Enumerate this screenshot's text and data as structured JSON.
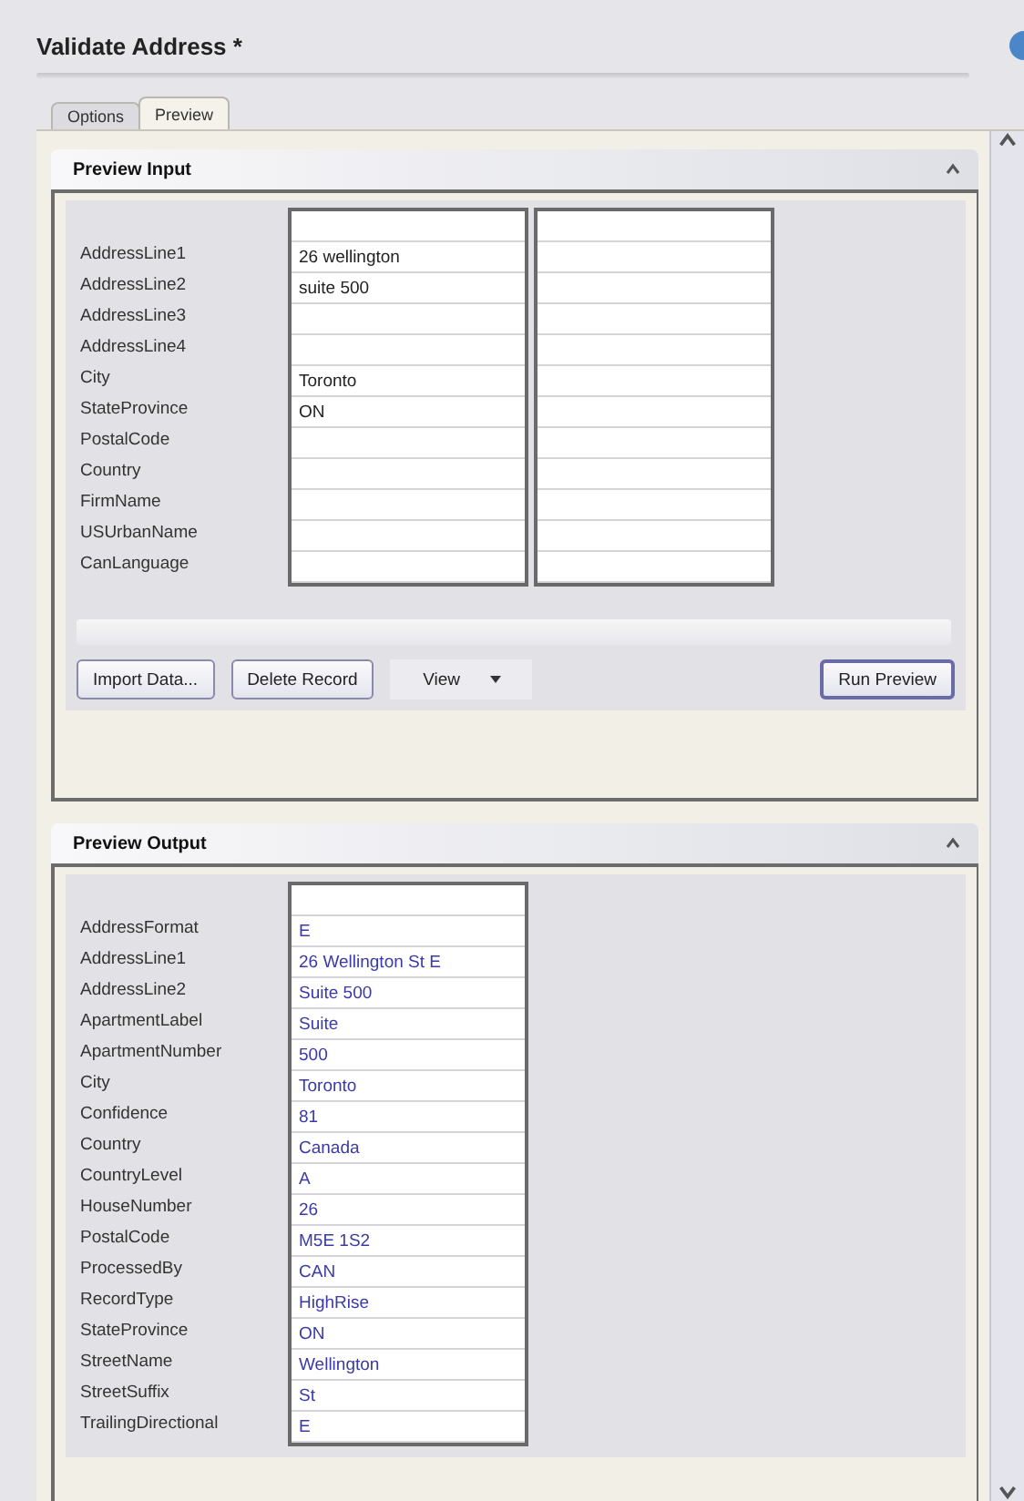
{
  "window": {
    "title": "Validate Address *"
  },
  "tabs": [
    {
      "label": "Options",
      "selected": false
    },
    {
      "label": "Preview",
      "selected": true
    }
  ],
  "preview_input": {
    "title": "Preview Input",
    "rows": [
      {
        "label": "AddressLine1",
        "value": "26 wellington"
      },
      {
        "label": "AddressLine2",
        "value": "suite 500"
      },
      {
        "label": "AddressLine3"
      },
      {
        "label": "AddressLine4"
      },
      {
        "label": "City",
        "value": "Toronto"
      },
      {
        "label": "StateProvince",
        "value": "ON"
      },
      {
        "label": "PostalCode"
      },
      {
        "label": "Country"
      },
      {
        "label": "FirmName"
      },
      {
        "label": "USUrbanName"
      },
      {
        "label": "CanLanguage"
      }
    ],
    "buttons": [
      {
        "label": "Import Data...",
        "kind": "button"
      },
      {
        "label": "Delete Record",
        "kind": "button"
      },
      {
        "label": "View",
        "kind": "dropdown"
      },
      {
        "label": "Run Preview",
        "kind": "primary"
      }
    ]
  },
  "preview_output": {
    "title": "Preview Output",
    "rows": [
      {
        "label": "AddressFormat",
        "value": "E"
      },
      {
        "label": "AddressLine1",
        "value": "26 Wellington St E"
      },
      {
        "label": "AddressLine2",
        "value": "Suite 500"
      },
      {
        "label": "ApartmentLabel",
        "value": "Suite"
      },
      {
        "label": "ApartmentNumber",
        "value": "500"
      },
      {
        "label": "City",
        "value": "Toronto"
      },
      {
        "label": "Confidence",
        "value": "81"
      },
      {
        "label": "Country",
        "value": "Canada"
      },
      {
        "label": "CountryLevel",
        "value": "A"
      },
      {
        "label": "HouseNumber",
        "value": "26"
      },
      {
        "label": "PostalCode",
        "value": "M5E 1S2"
      },
      {
        "label": "ProcessedBy",
        "value": "CAN"
      },
      {
        "label": "RecordType",
        "value": "HighRise"
      },
      {
        "label": "StateProvince",
        "value": "ON"
      },
      {
        "label": "StreetName",
        "value": "Wellington"
      },
      {
        "label": "StreetSuffix",
        "value": "St"
      },
      {
        "label": "TrailingDirectional",
        "value": "E"
      }
    ]
  }
}
